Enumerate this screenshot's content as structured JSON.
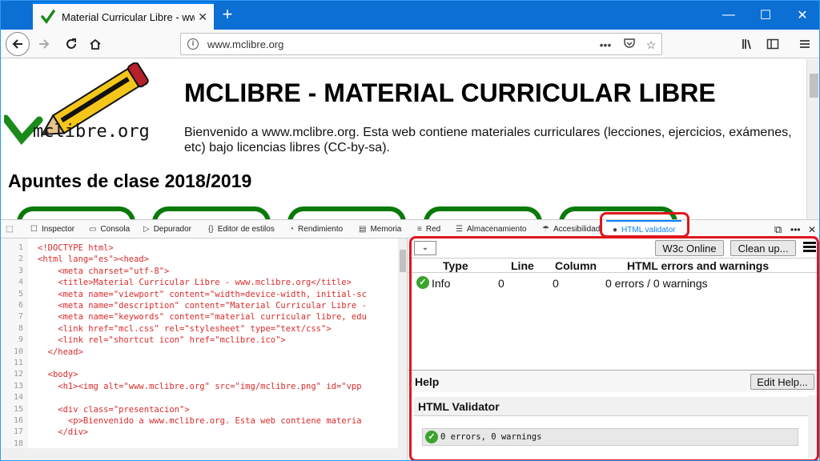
{
  "browser": {
    "tab_title": "Material Curricular Libre - www",
    "url": "www.mclibre.org"
  },
  "page": {
    "logo_text": "mclibre.org",
    "heading": "MCLIBRE - MATERIAL CURRICULAR LIBRE",
    "intro": "Bienvenido a www.mclibre.org. Esta web contiene materiales curriculares (lecciones, ejercicios, exámenes, etc) bajo licencias libres (CC-by-sa).",
    "subheading": "Apuntes de clase 2018/2019"
  },
  "devtools": {
    "tabs": [
      {
        "label": "Inspector",
        "icon": "inspector-icon"
      },
      {
        "label": "Consola",
        "icon": "console-icon"
      },
      {
        "label": "Depurador",
        "icon": "debugger-icon"
      },
      {
        "label": "Editor de estilos",
        "icon": "style-editor-icon"
      },
      {
        "label": "Rendimiento",
        "icon": "performance-icon"
      },
      {
        "label": "Memoria",
        "icon": "memory-icon"
      },
      {
        "label": "Red",
        "icon": "network-icon"
      },
      {
        "label": "Almacenamiento",
        "icon": "storage-icon"
      },
      {
        "label": "Accesibilidad",
        "icon": "accessibility-icon"
      },
      {
        "label": "HTML validator",
        "icon": "validator-icon"
      }
    ]
  },
  "code_lines": [
    {
      "n": "1",
      "text": "<!DOCTYPE html>"
    },
    {
      "n": "2",
      "text": "<html lang=\"es\"><head>"
    },
    {
      "n": "3",
      "text": "    <meta charset=\"utf-8\">"
    },
    {
      "n": "4",
      "text": "    <title>Material Curricular Libre - www.mclibre.org</title>"
    },
    {
      "n": "5",
      "text": "    <meta name=\"viewport\" content=\"width=device-width, initial-sc"
    },
    {
      "n": "6",
      "text": "    <meta name=\"description\" content=\"Material Curricular Libre -"
    },
    {
      "n": "7",
      "text": "    <meta name=\"keywords\" content=\"material curricular libre, edu"
    },
    {
      "n": "8",
      "text": "    <link href=\"mcl.css\" rel=\"stylesheet\" type=\"text/css\">"
    },
    {
      "n": "9",
      "text": "    <link rel=\"shortcut icon\" href=\"mclibre.ico\">"
    },
    {
      "n": "10",
      "text": "  </head>"
    },
    {
      "n": "11",
      "text": ""
    },
    {
      "n": "12",
      "text": "  <body>"
    },
    {
      "n": "13",
      "text": "    <h1><img alt=\"www.mclibre.org\" src=\"img/mclibre.png\" id=\"vpp"
    },
    {
      "n": "14",
      "text": ""
    },
    {
      "n": "15",
      "text": "    <div class=\"presentacion\">"
    },
    {
      "n": "16",
      "text": "      <p>Bienvenido a www.mclibre.org. Esta web contiene materia"
    },
    {
      "n": "17",
      "text": "    </div>"
    },
    {
      "n": "18",
      "text": ""
    }
  ],
  "validator": {
    "select_value": "",
    "w3c_button": "W3c Online",
    "cleanup_button": "Clean up...",
    "columns": [
      "Type",
      "Line",
      "Column",
      "HTML errors and warnings"
    ],
    "row": {
      "type": "Info",
      "line": "0",
      "column": "0",
      "message": "0 errors / 0 warnings"
    },
    "help_title": "Help",
    "edit_help_button": "Edit Help...",
    "help_heading": "HTML Validator",
    "help_result": "0 errors, 0 warnings"
  },
  "colors": {
    "titlebar": "#0c6fd4",
    "highlight": "#e0161d",
    "ok_green": "#3ba32e",
    "code_tag": "#d92b2b"
  }
}
